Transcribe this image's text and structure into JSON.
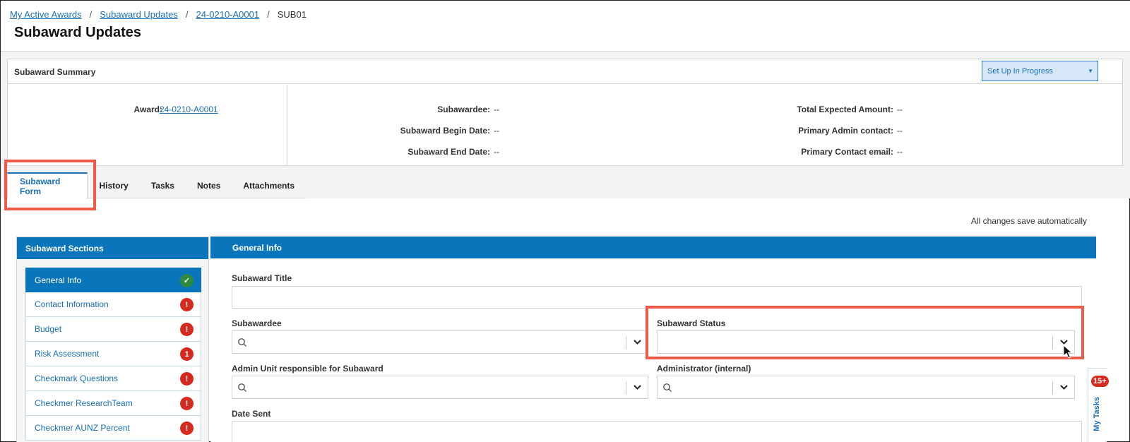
{
  "breadcrumb": {
    "items": [
      "My Active Awards",
      "Subaward Updates",
      "24-0210-A0001"
    ],
    "current": "SUB01",
    "separator": "/"
  },
  "page_title": "Subaward Updates",
  "summary": {
    "title": "Subaward Summary",
    "status_label": "Set Up In Progress",
    "award_label": "Award:",
    "award_value": "24-0210-A0001",
    "fields_left": [
      {
        "label": "Subawardee:",
        "value": "--"
      },
      {
        "label": "Subaward Begin Date:",
        "value": "--"
      },
      {
        "label": "Subaward End Date:",
        "value": "--"
      }
    ],
    "fields_right": [
      {
        "label": "Total Expected Amount:",
        "value": "--"
      },
      {
        "label": "Primary Admin contact:",
        "value": "--"
      },
      {
        "label": "Primary Contact email:",
        "value": "--"
      }
    ]
  },
  "tabs": [
    "Subaward Form",
    "History",
    "Tasks",
    "Notes",
    "Attachments"
  ],
  "autosave_text": "All changes save automatically",
  "sections_panel": {
    "title": "Subaward Sections",
    "items": [
      {
        "label": "General Info",
        "badge": "✓",
        "state": "complete"
      },
      {
        "label": "Contact Information",
        "badge": "!",
        "state": "error"
      },
      {
        "label": "Budget",
        "badge": "!",
        "state": "error"
      },
      {
        "label": "Risk Assessment",
        "badge": "1",
        "state": "error"
      },
      {
        "label": "Checkmark Questions",
        "badge": "!",
        "state": "error"
      },
      {
        "label": "Checkmer ResearchTeam",
        "badge": "!",
        "state": "error"
      },
      {
        "label": "Checkmer AUNZ Percent",
        "badge": "!",
        "state": "error"
      }
    ]
  },
  "form": {
    "title": "General Info",
    "subaward_title_label": "Subaward Title",
    "subawardee_label": "Subawardee",
    "subaward_status_label": "Subaward Status",
    "admin_unit_label": "Admin Unit responsible for Subaward",
    "administrator_label": "Administrator (internal)",
    "date_sent_label": "Date Sent"
  },
  "my_tasks": {
    "label": "My Tasks",
    "count": "15+"
  },
  "colors": {
    "accent": "#0b75bb",
    "highlight": "#ef5a4a",
    "error": "#d52b1e",
    "success": "#2e8b3e"
  }
}
